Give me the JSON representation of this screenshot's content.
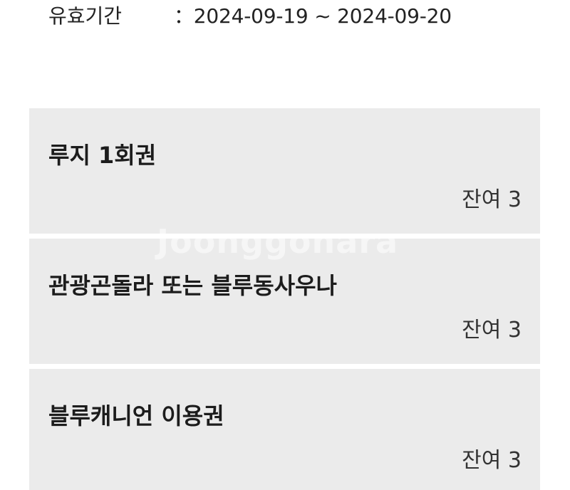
{
  "validity": {
    "label": "유효기간",
    "value": "：2024-09-19 ~ 2024-09-20"
  },
  "tickets": [
    {
      "name": "루지 1회권",
      "remaining": "잔여 3"
    },
    {
      "name": "관광곤돌라 또는 블루동사우나",
      "remaining": "잔여 3"
    },
    {
      "name": "블루캐니언 이용권",
      "remaining": "잔여 3"
    }
  ],
  "watermark": "Joonggonara",
  "colors": {
    "card_background": "#ebebeb",
    "text_primary": "#1c1c1c",
    "page_background": "#ffffff"
  }
}
